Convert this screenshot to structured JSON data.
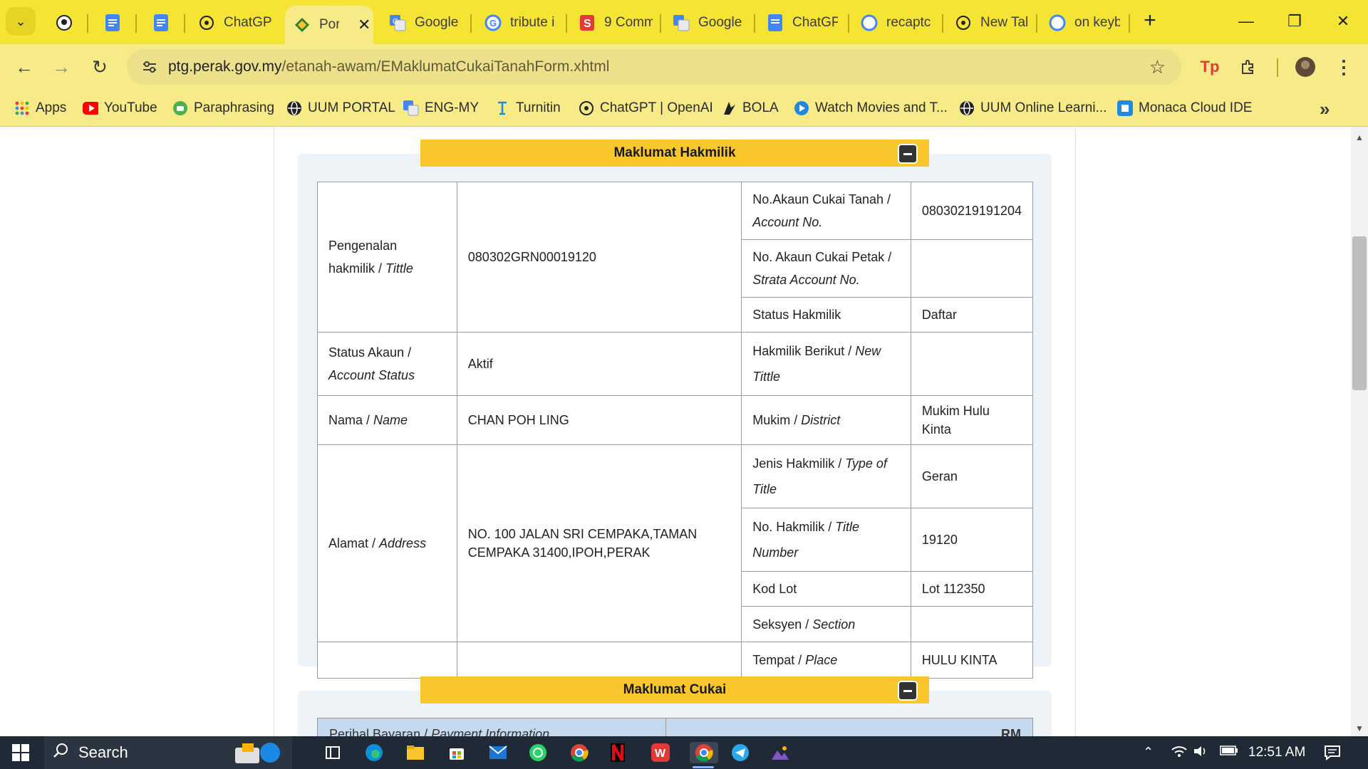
{
  "browser": {
    "tabs": [
      {
        "title": "ChatGPT",
        "icon": "openai-icon"
      },
      {
        "title": "Portal",
        "icon": "perak-logo-icon",
        "active": true
      },
      {
        "title": "Google",
        "icon": "google-translate-icon"
      },
      {
        "title": "tribute i",
        "icon": "google-icon"
      },
      {
        "title": "9 Comm",
        "icon": "s-logo-icon"
      },
      {
        "title": "Google",
        "icon": "google-translate-icon"
      },
      {
        "title": "ChatGP",
        "icon": "docs-icon"
      },
      {
        "title": "recaptc",
        "icon": "google-icon"
      },
      {
        "title": "New Tal",
        "icon": "openai-icon"
      },
      {
        "title": "on keyb",
        "icon": "google-icon"
      }
    ],
    "url_host": "ptg.perak.gov.my",
    "url_path": "/etanah-awam/EMaklumatCukaiTanahForm.xhtml"
  },
  "bookmarks": [
    {
      "label": "Apps",
      "icon": "apps-grid-icon"
    },
    {
      "label": "YouTube",
      "icon": "youtube-icon"
    },
    {
      "label": "Paraphrasing",
      "icon": "robot-icon"
    },
    {
      "label": "UUM PORTAL",
      "icon": "globe-icon"
    },
    {
      "label": "ENG-MY",
      "icon": "google-translate-icon"
    },
    {
      "label": "Turnitin",
      "icon": "turnitin-icon"
    },
    {
      "label": "ChatGPT | OpenAI",
      "icon": "openai-icon"
    },
    {
      "label": "BOLA",
      "icon": "bola-icon"
    },
    {
      "label": "Watch Movies and T...",
      "icon": "play-icon"
    },
    {
      "label": "UUM Online Learni...",
      "icon": "globe-icon"
    },
    {
      "label": "Monaca Cloud IDE",
      "icon": "monaca-icon"
    }
  ],
  "section1": {
    "title": "Maklumat Hakmilik",
    "rows": {
      "title_id_label": "Pengenalan hakmilik / ",
      "title_id_label_en": "Tittle",
      "title_id_value": "080302GRN00019120",
      "account_no_label": "No.Akaun Cukai Tanah / ",
      "account_no_label_en": "Account No.",
      "account_no_value": "08030219191204",
      "strata_label": "No. Akaun Cukai Petak / ",
      "strata_label_en": "Strata Account No.",
      "strata_value": "",
      "status_hakmilik_label": "Status Hakmilik",
      "status_hakmilik_value": "Daftar",
      "account_status_label": "Status Akaun / ",
      "account_status_label_en": "Account Status",
      "account_status_value": "Aktif",
      "new_title_label": "Hakmilik Berikut / ",
      "new_title_label_en": "New Tittle",
      "new_title_value": "",
      "name_label": "Nama / ",
      "name_label_en": "Name",
      "name_value": "CHAN POH LING",
      "district_label": "Mukim / ",
      "district_label_en": "District",
      "district_value": "Mukim Hulu Kinta",
      "address_label": "Alamat / ",
      "address_label_en": "Address",
      "address_value": "NO. 100 JALAN SRI CEMPAKA,TAMAN CEMPAKA 31400,IPOH,PERAK",
      "type_label": "Jenis Hakmilik / ",
      "type_label_en": "Type of Title",
      "type_value": "Geran",
      "title_no_label": "No. Hakmilik / ",
      "title_no_label_en": "Title Number",
      "title_no_value": "19120",
      "lot_label": "Kod Lot",
      "lot_value": "Lot 112350",
      "section_label": "Seksyen / ",
      "section_label_en": "Section",
      "section_value": "",
      "place_label": "Tempat / ",
      "place_label_en": "Place",
      "place_value": "HULU KINTA"
    }
  },
  "section2": {
    "title": "Maklumat Cukai",
    "payment_header": "Perihal Bayaran / ",
    "payment_header_en": "Payment Information",
    "currency": "RM"
  },
  "taskbar": {
    "search_label": "Search",
    "time": "12:51 AM"
  },
  "colors": {
    "chrome_yellow": "#f5e434",
    "panel_header": "#f9c72c"
  }
}
